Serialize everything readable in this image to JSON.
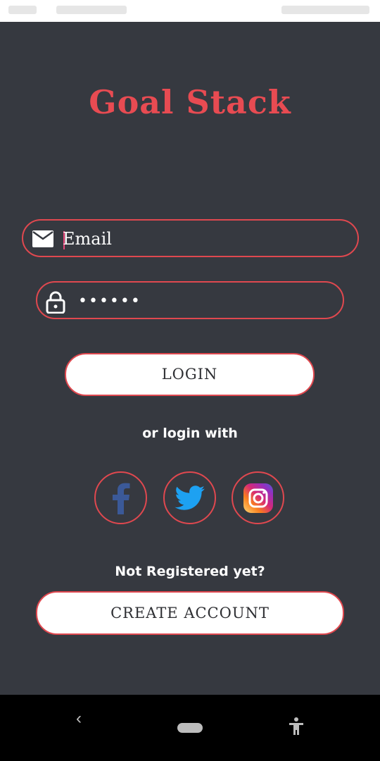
{
  "app": {
    "title": "Goal Stack"
  },
  "email_field": {
    "placeholder": "Email",
    "icon": "mail-icon"
  },
  "password_field": {
    "masked_value": "••••••",
    "icon": "lock-icon"
  },
  "login_button": {
    "label": "LOGIN"
  },
  "social": {
    "caption": "or login with",
    "buttons": [
      {
        "name": "facebook",
        "icon": "facebook-icon"
      },
      {
        "name": "twitter",
        "icon": "twitter-icon"
      },
      {
        "name": "instagram",
        "icon": "instagram-icon"
      }
    ]
  },
  "register": {
    "caption": "Not Registered yet?",
    "create_label": "CREATE ACCOUNT"
  },
  "colors": {
    "background": "#363940",
    "accent": "#e84b52",
    "button_bg": "#ffffff"
  },
  "nav_bar": {
    "back_glyph": "‹"
  }
}
